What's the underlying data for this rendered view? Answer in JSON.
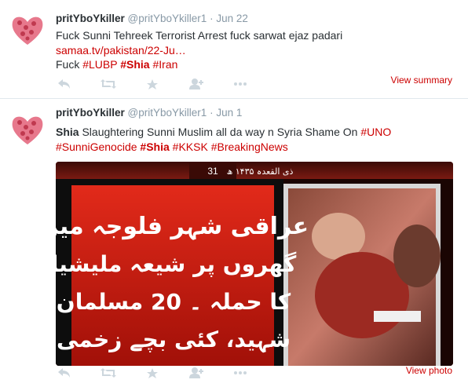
{
  "tweets": [
    {
      "name": "pritYboYkiller",
      "handle": "@pritYboYkiller1",
      "dot": "·",
      "time": "Jun 22",
      "line1": "Fuck Sunni Tehreek Terrorist Arrest fuck sarwat ejaz padari",
      "link": "samaa.tv/pakistan/22-Ju…",
      "line3_prefix": "Fuck ",
      "tags": [
        "#LUBP",
        "#Shia",
        "#Iran"
      ],
      "view_label": "View summary"
    },
    {
      "name": "pritYboYkiller",
      "handle": "@pritYboYkiller1",
      "dot": "·",
      "time": "Jun 1",
      "line1_bold": "Shia",
      "line1_text": " Slaughtering Sunni Muslim all da way n Syria Shame On ",
      "line1_tag": "#UNO",
      "tags2": [
        "#SunniGenocide",
        "#Shia",
        "#KKSK",
        "#BreakingNews"
      ],
      "view_label": "View photo",
      "photo": {
        "top_number": "31",
        "urdu_lines": [
          "عراقی شہر فلوجہ میں",
          "گھروں پر شیعہ ملیشیا",
          "کا حملہ ۔ 20 مسلمان",
          "شہید، کئی بچے زخمی"
        ]
      }
    }
  ],
  "icons": [
    "reply-icon",
    "retweet-icon",
    "favorite-icon",
    "follow-icon",
    "more-icon"
  ],
  "colors": {
    "link": "#cc0000",
    "muted": "#8899a6",
    "icon": "#ccd6dd"
  }
}
